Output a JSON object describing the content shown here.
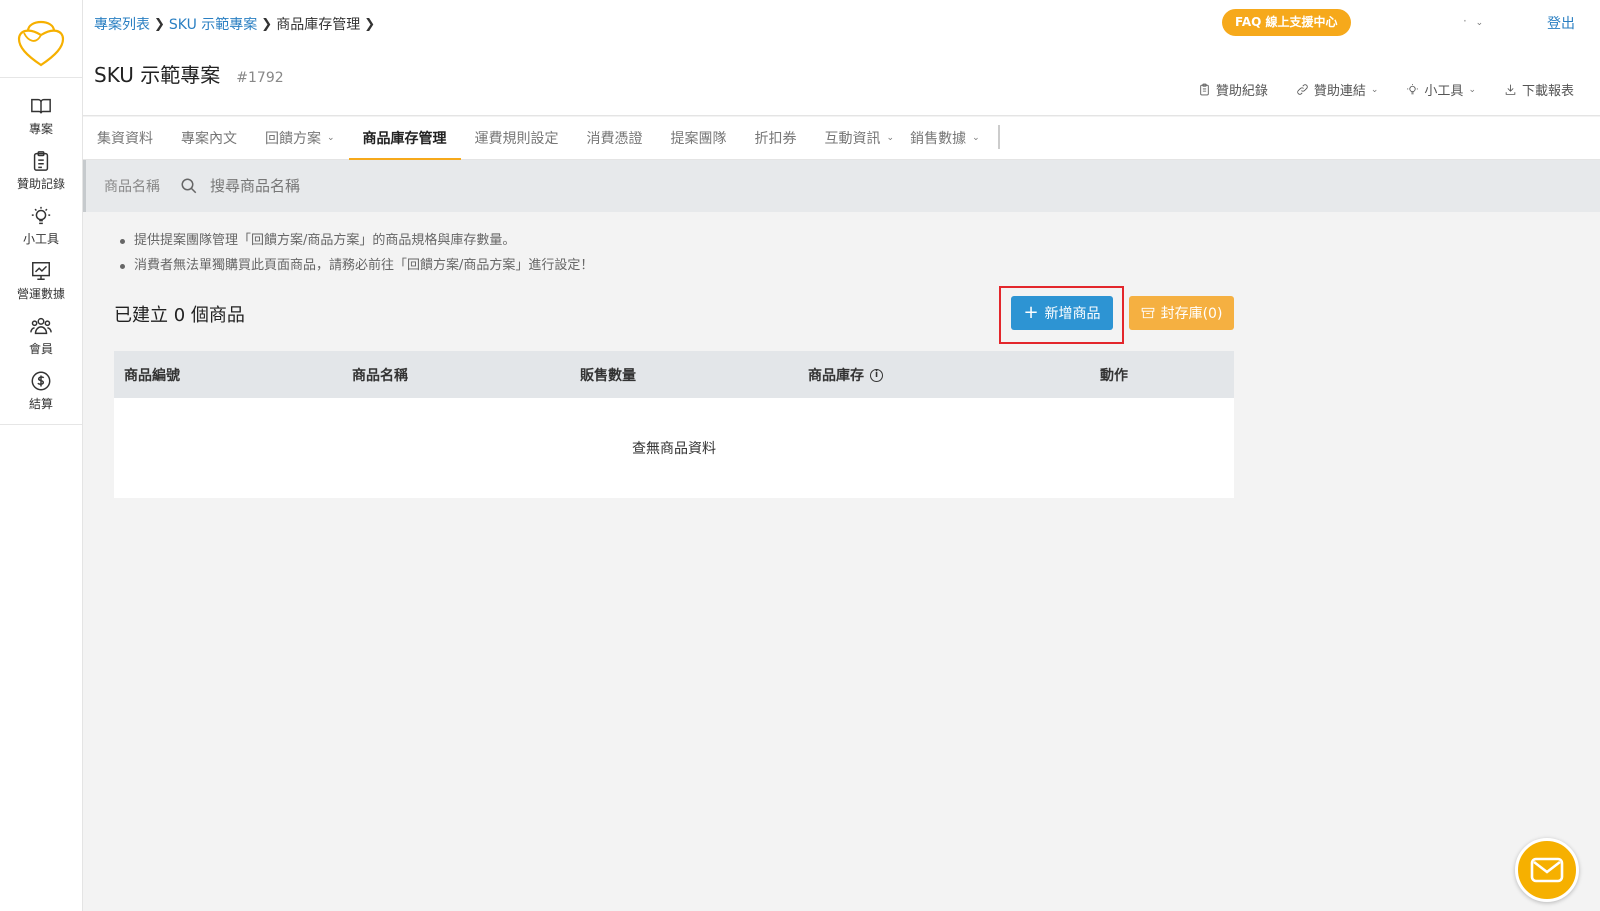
{
  "sidebar": {
    "logo": "logo",
    "items": [
      {
        "label": "專案",
        "icon": "book-icon"
      },
      {
        "label": "贊助記錄",
        "icon": "clipboard-icon"
      },
      {
        "label": "小工具",
        "icon": "lightbulb-icon"
      },
      {
        "label": "營運數據",
        "icon": "chart-icon"
      },
      {
        "label": "會員",
        "icon": "users-icon"
      },
      {
        "label": "結算",
        "icon": "dollar-icon"
      }
    ]
  },
  "header": {
    "breadcrumb": [
      "專案列表",
      "SKU 示範專案",
      "商品庫存管理"
    ],
    "faq_label": "FAQ 線上支援中心",
    "user_menu": "·",
    "logout_label": "登出",
    "title": "SKU 示範專案",
    "project_id": "#1792",
    "tools": [
      {
        "label": "贊助紀錄",
        "icon": "clipboard-icon"
      },
      {
        "label": "贊助連結",
        "icon": "link-icon"
      },
      {
        "label": "小工具",
        "icon": "lightbulb-icon"
      },
      {
        "label": "下載報表",
        "icon": "download-icon"
      }
    ]
  },
  "tabs": [
    {
      "label": "集資資料"
    },
    {
      "label": "專案內文"
    },
    {
      "label": "回饋方案"
    },
    {
      "label": "商品庫存管理"
    },
    {
      "label": "運費規則設定"
    },
    {
      "label": "消費憑證"
    },
    {
      "label": "提案團隊"
    },
    {
      "label": "折扣券"
    },
    {
      "label": "互動資訊"
    },
    {
      "label": "銷售數據"
    }
  ],
  "search": {
    "label": "商品名稱",
    "placeholder": "搜尋商品名稱"
  },
  "notes": [
    "提供提案團隊管理「回饋方案/商品方案」的商品規格與庫存數量。",
    "消費者無法單獨購買此頁面商品，請務必前往「回饋方案/商品方案」進行設定！"
  ],
  "product_count_text": "已建立 0 個商品",
  "add_button_label": "新增商品",
  "archive_button_label": "封存庫(0)",
  "table": {
    "columns": [
      "商品編號",
      "商品名稱",
      "販售數量",
      "商品庫存",
      "動作"
    ],
    "empty_text": "查無商品資料"
  },
  "colors": {
    "accent": "#f6a91b",
    "primary": "#2d94d3",
    "link": "#2a7fc2",
    "highlight": "#e3262b"
  }
}
